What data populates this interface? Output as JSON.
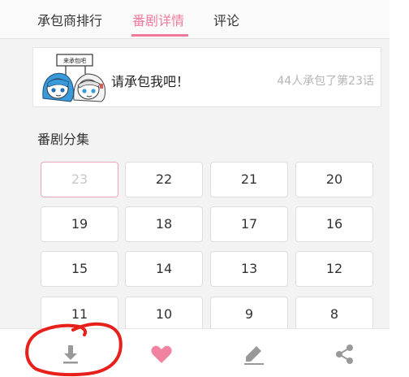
{
  "tabs": [
    {
      "label": "承包商排行",
      "active": false
    },
    {
      "label": "番剧详情",
      "active": true
    },
    {
      "label": "评论",
      "active": false
    }
  ],
  "sponsor": {
    "mascot_sign": "来承包吧",
    "prompt": "请承包我吧！",
    "count_text": "44人承包了第23话"
  },
  "episodes": {
    "title": "番剧分集",
    "items": [
      "23",
      "22",
      "21",
      "20",
      "19",
      "18",
      "17",
      "16",
      "15",
      "14",
      "13",
      "12",
      "11",
      "10",
      "9",
      "8"
    ],
    "current": "23"
  },
  "toolbar": {
    "items": [
      "download-icon",
      "heart-icon",
      "pencil-icon",
      "share-icon"
    ]
  },
  "colors": {
    "accent": "#ee7b9c",
    "heart": "#f0839f",
    "icon": "#999999",
    "annotation": "#e8201c"
  }
}
